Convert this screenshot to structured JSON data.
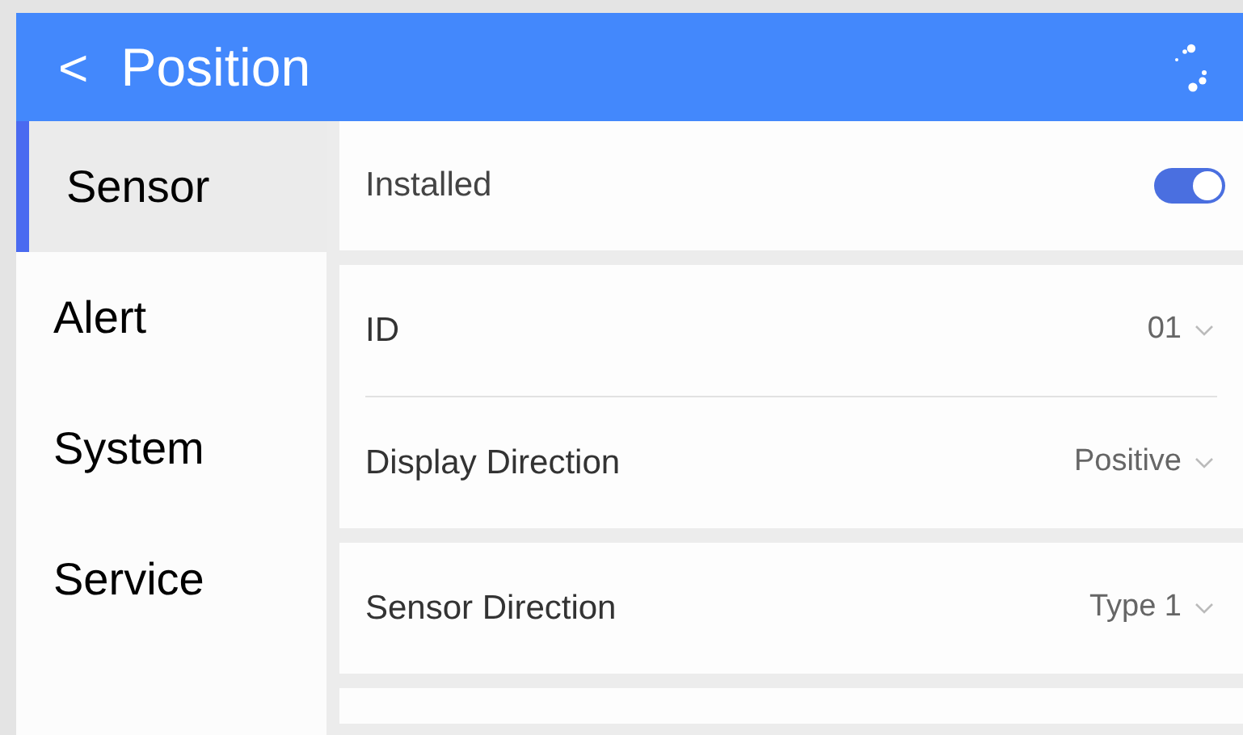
{
  "header": {
    "back_icon": "<",
    "title": "Position"
  },
  "sidebar": {
    "items": [
      {
        "label": "Sensor",
        "selected": true
      },
      {
        "label": "Alert",
        "selected": false
      },
      {
        "label": "System",
        "selected": false
      },
      {
        "label": "Service",
        "selected": false
      }
    ]
  },
  "cards": [
    {
      "rows": [
        {
          "kind": "toggle",
          "label": "Installed",
          "on": true
        }
      ]
    },
    {
      "rows": [
        {
          "kind": "select",
          "label": "ID",
          "value": "01"
        },
        {
          "kind": "select",
          "label": "Display Direction",
          "value": "Positive"
        }
      ]
    },
    {
      "rows": [
        {
          "kind": "select",
          "label": "Sensor Direction",
          "value": "Type 1"
        }
      ]
    }
  ]
}
